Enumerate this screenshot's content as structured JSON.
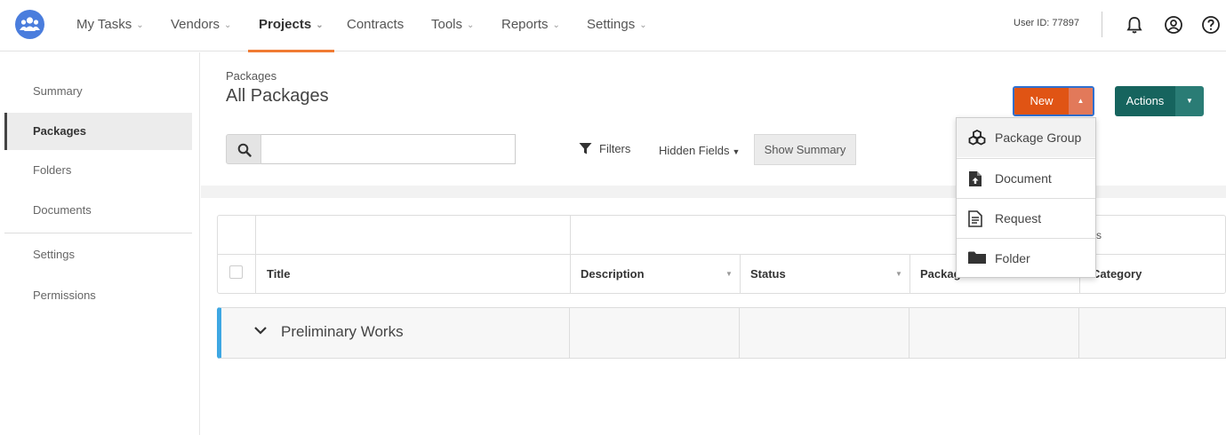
{
  "nav": {
    "items": [
      {
        "label": "My Tasks",
        "has_dropdown": true,
        "active": false
      },
      {
        "label": "Vendors",
        "has_dropdown": true,
        "active": false
      },
      {
        "label": "Projects",
        "has_dropdown": true,
        "active": true
      },
      {
        "label": "Contracts",
        "has_dropdown": false,
        "active": false
      },
      {
        "label": "Tools",
        "has_dropdown": true,
        "active": false
      },
      {
        "label": "Reports",
        "has_dropdown": true,
        "active": false
      },
      {
        "label": "Settings",
        "has_dropdown": true,
        "active": false
      }
    ],
    "user_id": "User ID: 77897",
    "icons": [
      "logo-icon",
      "bell-icon",
      "user-icon",
      "help-icon"
    ]
  },
  "sidebar": {
    "items": [
      {
        "label": "Summary",
        "active": false
      },
      {
        "label": "Packages",
        "active": true
      },
      {
        "label": "Folders",
        "active": false
      },
      {
        "label": "Documents",
        "active": false
      },
      {
        "label": "Settings",
        "active": false
      },
      {
        "label": "Permissions",
        "active": false
      }
    ]
  },
  "main": {
    "breadcrumb": "Packages",
    "title": "All Packages",
    "search": {
      "value": "",
      "placeholder": ""
    },
    "filters_label": "Filters",
    "hidden_fields_label": "Hidden Fields",
    "show_summary_label": "Show Summary",
    "new_button_label": "New",
    "actions_button_label": "Actions"
  },
  "new_menu": {
    "items": [
      {
        "label": "Package Group",
        "icon": "package-group-icon",
        "highlighted": true
      },
      {
        "label": "Document",
        "icon": "document-upload-icon",
        "highlighted": false
      },
      {
        "label": "Request",
        "icon": "request-icon",
        "highlighted": false
      },
      {
        "label": "Folder",
        "icon": "folder-icon",
        "highlighted": false
      }
    ]
  },
  "table": {
    "group_header_fragment": "s",
    "columns": [
      {
        "label": "Title",
        "sortable": false
      },
      {
        "label": "Description",
        "sortable": true
      },
      {
        "label": "Status",
        "sortable": true
      },
      {
        "label": "Packag",
        "sortable": false
      },
      {
        "label": "Category",
        "sortable": false
      }
    ],
    "groups": [
      {
        "label": "Preliminary Works",
        "expanded": true
      }
    ]
  },
  "colors": {
    "accent_orange": "#e05414",
    "actions_teal": "#16645e",
    "group_stripe": "#3da7e3",
    "nav_active_underline": "#f07b33",
    "logo_blue": "#4a7ddd"
  }
}
